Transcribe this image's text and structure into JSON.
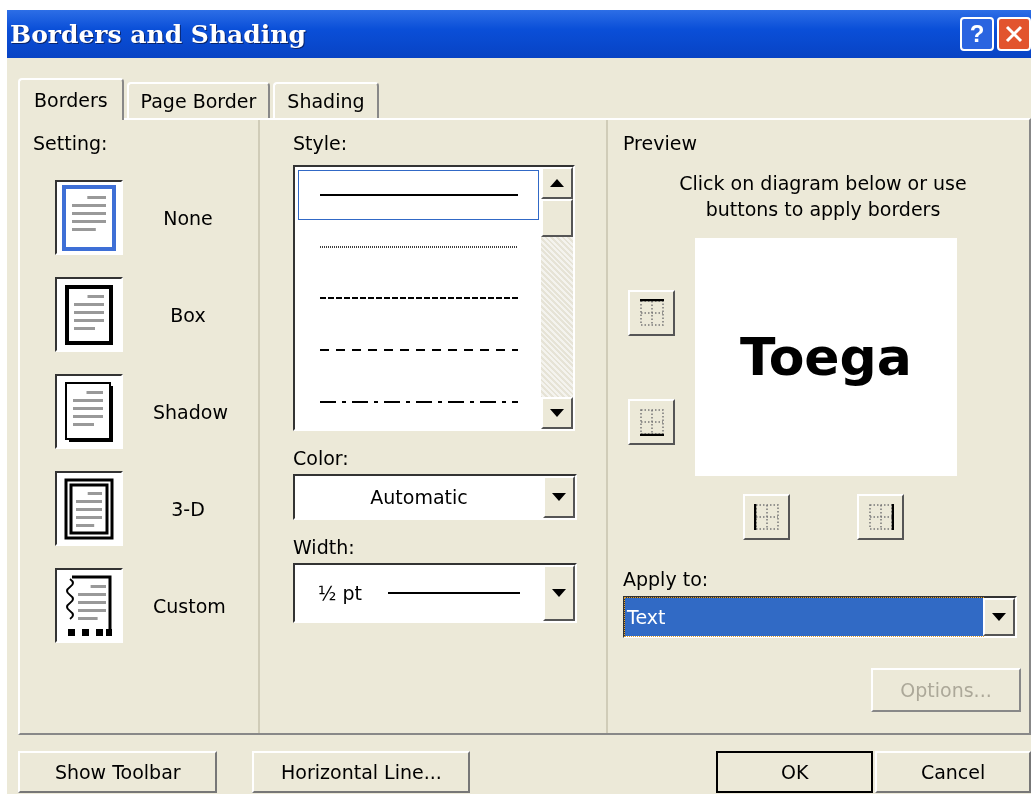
{
  "window": {
    "title": "Borders and Shading"
  },
  "title_buttons": [
    {
      "kind": "help",
      "label": "?"
    },
    {
      "kind": "close"
    }
  ],
  "tabs": [
    {
      "label": "Borders",
      "selected": true
    },
    {
      "label": "Page Border",
      "selected": false
    },
    {
      "label": "Shading",
      "selected": false
    }
  ],
  "setting": {
    "label": "Setting:",
    "options": [
      {
        "kind": "none",
        "label": "None"
      },
      {
        "kind": "box",
        "label": "Box"
      },
      {
        "kind": "shadow",
        "label": "Shadow"
      },
      {
        "kind": "deep",
        "label": "3-D"
      },
      {
        "kind": "custom",
        "label": "Custom"
      }
    ]
  },
  "style": {
    "label": "Style:",
    "items": [
      {
        "kind": "solid",
        "selected": true
      },
      {
        "kind": "dotted",
        "selected": false
      },
      {
        "kind": "dashed",
        "selected": false
      },
      {
        "kind": "spaced",
        "selected": false
      },
      {
        "kind": "dashdot",
        "selected": false
      }
    ]
  },
  "color": {
    "label": "Color:",
    "value": "Automatic"
  },
  "width": {
    "label": "Width:",
    "value": "½ pt"
  },
  "preview": {
    "label": "Preview",
    "hint": "Click on diagram below or use buttons to apply borders",
    "sample": "Toega",
    "side_buttons": [
      {
        "kind": "top"
      },
      {
        "kind": "bottom"
      },
      {
        "kind": "left"
      },
      {
        "kind": "right"
      }
    ]
  },
  "apply_to": {
    "label": "Apply to:",
    "value": "Text",
    "focused": true
  },
  "options_button": {
    "label": "Options...",
    "disabled": true
  },
  "footer_buttons": [
    {
      "label": "Show Toolbar",
      "default": false
    },
    {
      "label": "Horizontal Line...",
      "default": false
    },
    {
      "label": "OK",
      "default": true
    },
    {
      "label": "Cancel",
      "default": false
    }
  ]
}
